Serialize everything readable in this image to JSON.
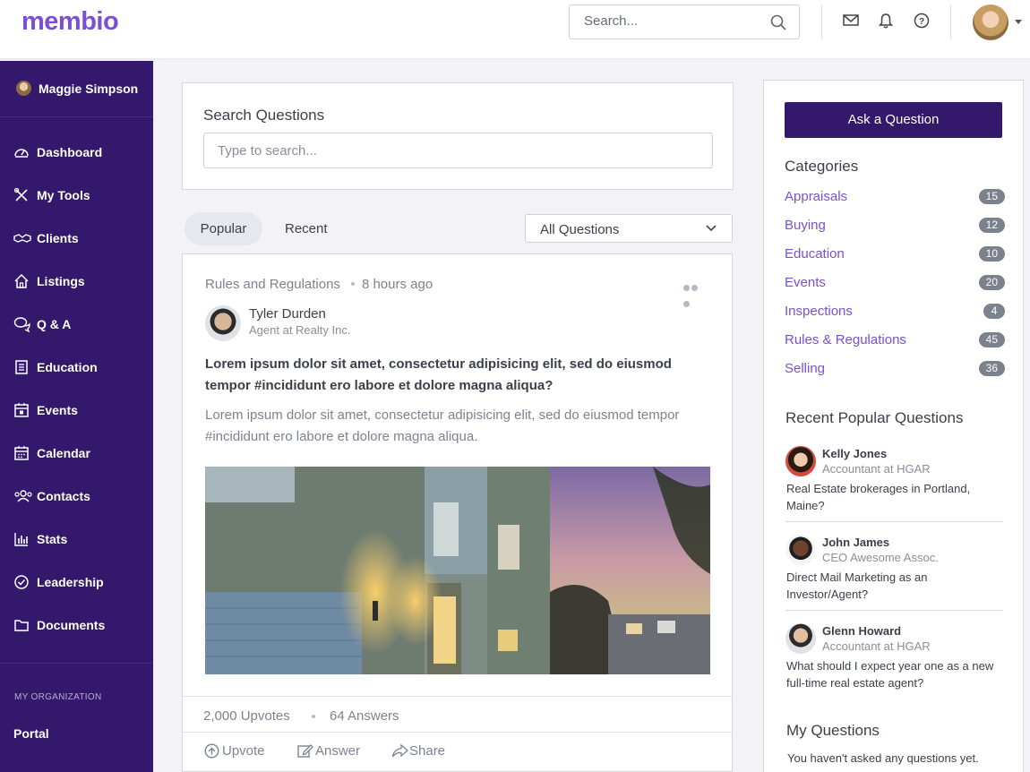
{
  "app": {
    "logo": "membio"
  },
  "topbar": {
    "search_placeholder": "Search...",
    "icons": [
      "search-icon",
      "mail-icon",
      "bell-icon",
      "help-icon",
      "avatar",
      "caret-down-icon"
    ]
  },
  "sidebar": {
    "user_name": "Maggie Simpson",
    "items": [
      {
        "label": "Dashboard",
        "icon": "dashboard-icon"
      },
      {
        "label": "My Tools",
        "icon": "tools-icon"
      },
      {
        "label": "Clients",
        "icon": "handshake-icon"
      },
      {
        "label": "Listings",
        "icon": "home-icon"
      },
      {
        "label": "Q & A",
        "icon": "chat-icon"
      },
      {
        "label": "Education",
        "icon": "book-icon"
      },
      {
        "label": "Events",
        "icon": "calendar-star-icon"
      },
      {
        "label": "Calendar",
        "icon": "calendar-icon"
      },
      {
        "label": "Contacts",
        "icon": "contacts-icon"
      },
      {
        "label": "Stats",
        "icon": "chart-icon"
      },
      {
        "label": "Leadership",
        "icon": "check-circle-icon"
      },
      {
        "label": "Documents",
        "icon": "folder-icon"
      }
    ],
    "org_label": "MY ORGANIZATION",
    "portal_label": "Portal"
  },
  "search_questions": {
    "title": "Search Questions",
    "placeholder": "Type to search..."
  },
  "tabs": {
    "popular": "Popular",
    "recent": "Recent"
  },
  "filter": {
    "selected": "All Questions"
  },
  "post": {
    "category": "Rules and Regulations",
    "time": "8 hours ago",
    "author_name": "Tyler Durden",
    "author_role": "Agent at Realty Inc.",
    "title": "Lorem ipsum dolor sit amet, consectetur adipisicing elit, sed do eiusmod tempor #incididunt ero labore et dolore magna aliqua?",
    "body": "Lorem ipsum dolor sit amet, consectetur adipisicing elit, sed do eiusmod tempor #incididunt ero labore et dolore magna aliqua.",
    "upvotes": "2,000 Upvotes",
    "answers": "64 Answers",
    "actions": {
      "upvote": "Upvote",
      "answer": "Answer",
      "share": "Share"
    }
  },
  "right": {
    "ask_button": "Ask a Question",
    "categories_title": "Categories",
    "categories": [
      {
        "name": "Appraisals",
        "count": "15"
      },
      {
        "name": "Buying",
        "count": "12"
      },
      {
        "name": "Education",
        "count": "10"
      },
      {
        "name": "Events",
        "count": "20"
      },
      {
        "name": "Inspections",
        "count": "4"
      },
      {
        "name": "Rules & Regulations",
        "count": "45"
      },
      {
        "name": "Selling",
        "count": "36"
      }
    ],
    "recent_title": "Recent Popular Questions",
    "recent": [
      {
        "name": "Kelly Jones",
        "role": "Accountant at HGAR",
        "question": "Real Estate brokerages in Portland, Maine?"
      },
      {
        "name": "John James",
        "role": "CEO Awesome Assoc.",
        "question": "Direct Mail Marketing as an Investor/Agent?"
      },
      {
        "name": "Glenn Howard",
        "role": "Accountant at HGAR",
        "question": "What should I expect year one as a new full-time real estate agent?"
      }
    ],
    "my_questions_title": "My Questions",
    "my_questions_empty": "You haven't asked any questions yet."
  },
  "colors": {
    "brand": "#7a4fd6",
    "sidebar": "#33186b",
    "badge": "#7c818e"
  }
}
